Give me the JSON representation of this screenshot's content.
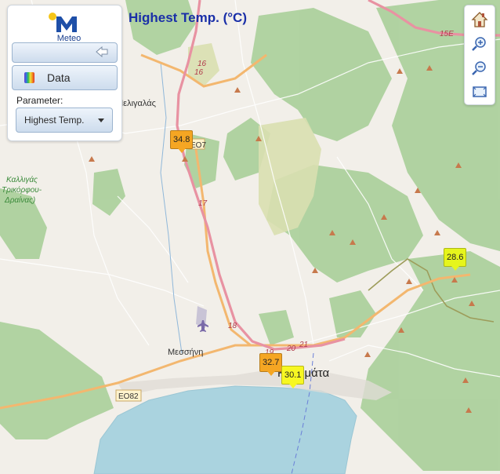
{
  "title": "Highest Temp. (°C)",
  "panel": {
    "logo_text": "Meteo",
    "data_button_label": "Data",
    "parameter_label": "Parameter:",
    "parameter_value": "Highest Temp."
  },
  "tools": [
    "home-icon",
    "zoom-in-icon",
    "zoom-out-icon",
    "fullscreen-icon"
  ],
  "markers": [
    {
      "value": "34.8",
      "color": "#f5a623"
    },
    {
      "value": "32.7",
      "color": "#f5a623"
    },
    {
      "value": "30.1",
      "color": "#f7f722"
    },
    {
      "value": "28.6",
      "color": "#e6f51c"
    }
  ],
  "places": {
    "meligalas": "Μελιγαλάς",
    "kalligas": "Καλλιγάς",
    "trikorfou": "Τρικόρφου-",
    "draina": "Δραίνας)",
    "messini": "Μεσσήνη",
    "kalamata": "Καλαμάτα"
  },
  "roads": {
    "eo7": "ΕΟ7",
    "eo82": "ΕΟ82",
    "r15e": "15E",
    "r16a": "16",
    "r16b": "16",
    "r17": "17",
    "r18": "18",
    "r19": "19",
    "r20": "20",
    "r21": "21"
  },
  "colors": {
    "land": "#f2efe9",
    "forest": "#add19e",
    "sea": "#aad3df",
    "motorway": "#e892a2",
    "primary_road": "#fcd6a4",
    "title": "#1a2fa8"
  }
}
